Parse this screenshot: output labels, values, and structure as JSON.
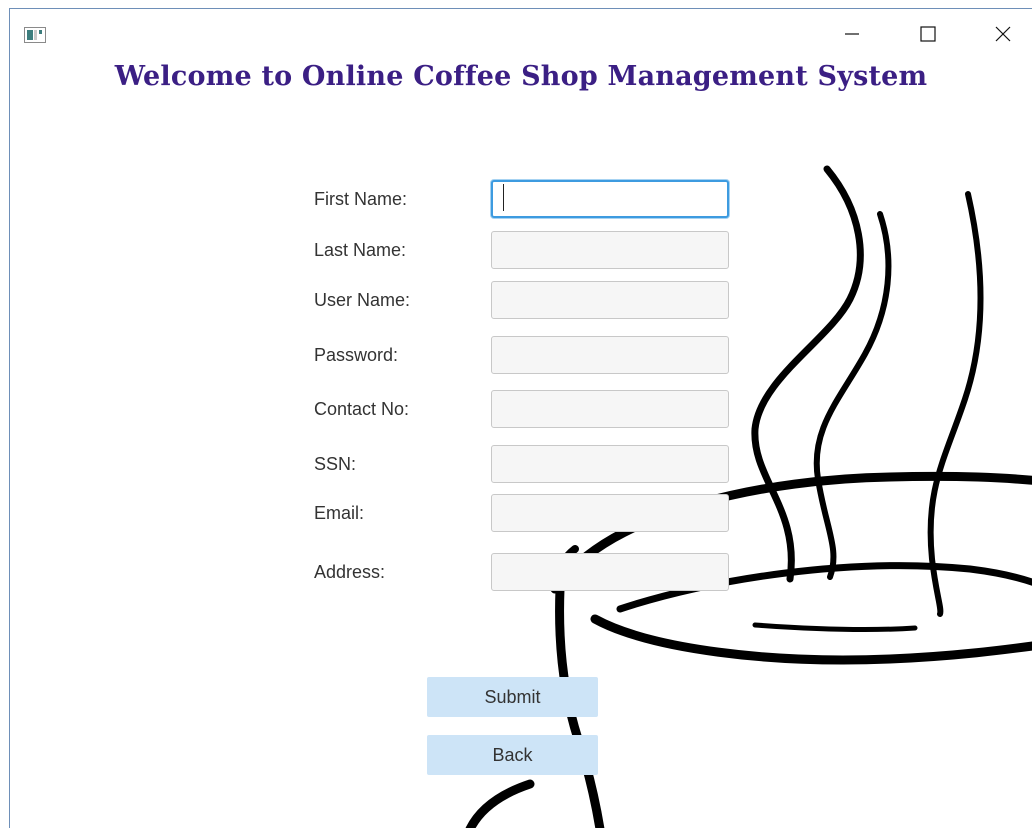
{
  "window": {
    "icon": "app-window-icon",
    "controls": {
      "minimize": "minimize-icon",
      "maximize": "maximize-icon",
      "close": "close-icon"
    }
  },
  "heading": "Welcome to Online Coffee Shop Management System",
  "form": {
    "fields": [
      {
        "label": "First Name:",
        "value": ""
      },
      {
        "label": "Last Name:",
        "value": ""
      },
      {
        "label": "User Name:",
        "value": ""
      },
      {
        "label": "Password:",
        "value": ""
      },
      {
        "label": "Contact No:",
        "value": ""
      },
      {
        "label": "SSN:",
        "value": ""
      },
      {
        "label": "Email:",
        "value": ""
      },
      {
        "label": "Address:",
        "value": ""
      }
    ],
    "focused_field": "First Name:"
  },
  "buttons": {
    "submit": "Submit",
    "back": "Back"
  },
  "background": {
    "illustration": "coffee-cup-illustration"
  },
  "colors": {
    "heading": "#3b1f84",
    "button_bg": "#cde4f7",
    "focus_border": "#3d9be0",
    "window_border": "#6e8fb8"
  }
}
